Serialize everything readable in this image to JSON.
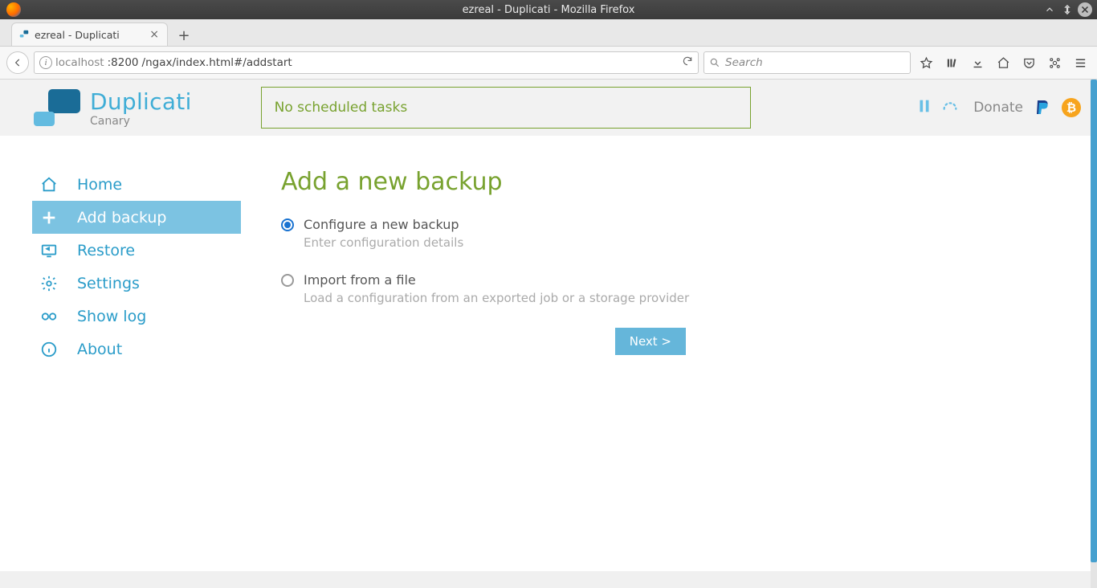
{
  "window": {
    "title": "ezreal - Duplicati - Mozilla Firefox"
  },
  "tabs": [
    {
      "title": "ezreal - Duplicati"
    }
  ],
  "url": {
    "host": "localhost",
    "port": ":8200",
    "path": "/ngax/index.html#/addstart"
  },
  "search": {
    "placeholder": "Search"
  },
  "app": {
    "brand": "Duplicati",
    "channel": "Canary",
    "status": "No scheduled tasks",
    "donate": "Donate"
  },
  "sidebar": {
    "items": [
      {
        "label": "Home"
      },
      {
        "label": "Add backup"
      },
      {
        "label": "Restore"
      },
      {
        "label": "Settings"
      },
      {
        "label": "Show log"
      },
      {
        "label": "About"
      }
    ]
  },
  "page": {
    "title": "Add a new backup",
    "option1_title": "Configure a new backup",
    "option1_sub": "Enter configuration details",
    "option2_title": "Import from a file",
    "option2_sub": "Load a configuration from an exported job or a storage provider",
    "next": "Next >"
  }
}
